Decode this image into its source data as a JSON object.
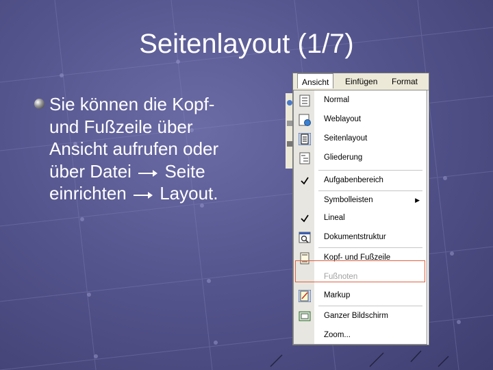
{
  "slide": {
    "title": "Seitenlayout (1/7)",
    "bullet": {
      "line1": "Sie können die Kopf-",
      "line2": "und Fußzeile über",
      "line3": "Ansicht aufrufen oder",
      "line4a": "über Datei",
      "line4b": "Seite",
      "line5a": "einrichten",
      "line5b": "Layout."
    }
  },
  "menubar": {
    "items": [
      "Ansicht",
      "Einfügen",
      "Format"
    ]
  },
  "menu": {
    "items": [
      {
        "label": "Normal",
        "icon": "normal-view-icon"
      },
      {
        "label": "Weblayout",
        "icon": "web-layout-icon"
      },
      {
        "label": "Seitenlayout",
        "icon": "page-layout-icon"
      },
      {
        "label": "Gliederung",
        "icon": "outline-icon"
      },
      {
        "label": "Aufgabenbereich",
        "icon": "checkmark-icon"
      },
      {
        "label": "Symbolleisten",
        "icon": ""
      },
      {
        "label": "Lineal",
        "icon": "checkmark-icon"
      },
      {
        "label": "Dokumentstruktur",
        "icon": "document-map-icon"
      },
      {
        "label": "Kopf- und Fußzeile",
        "icon": "header-footer-icon"
      },
      {
        "label": "Fußnoten",
        "icon": ""
      },
      {
        "label": "Markup",
        "icon": "markup-icon"
      },
      {
        "label": "Ganzer Bildschirm",
        "icon": "full-screen-icon"
      },
      {
        "label": "Zoom...",
        "icon": ""
      }
    ]
  },
  "colors": {
    "background": "#55558e",
    "highlight_border": "#e06040"
  }
}
